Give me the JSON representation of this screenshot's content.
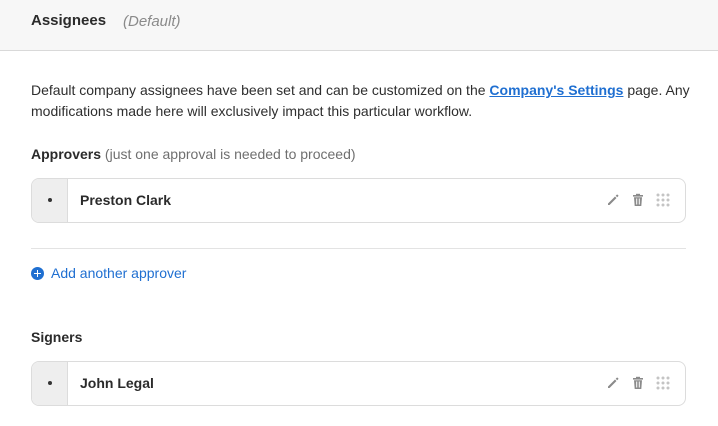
{
  "header": {
    "title": "Assignees",
    "subtitle": "(Default)"
  },
  "description": {
    "before_link": "Default company assignees have been set and can be customized on the ",
    "link_text": "Company's Settings",
    "after_link": " page. Any modifications made here will exclusively impact this particular workflow."
  },
  "approvers": {
    "label": "Approvers",
    "note": "(just one approval is needed to proceed)",
    "items": [
      {
        "name": "Preston Clark"
      }
    ],
    "add_label": "Add another approver"
  },
  "signers": {
    "label": "Signers",
    "items": [
      {
        "name": "John Legal"
      }
    ]
  },
  "icons": {
    "edit": "pencil-icon",
    "delete": "trash-icon",
    "drag": "drag-handle-icon",
    "add": "plus-circle-icon"
  },
  "colors": {
    "accent": "#1f6fd1",
    "header_bg": "#f7f7f7"
  }
}
